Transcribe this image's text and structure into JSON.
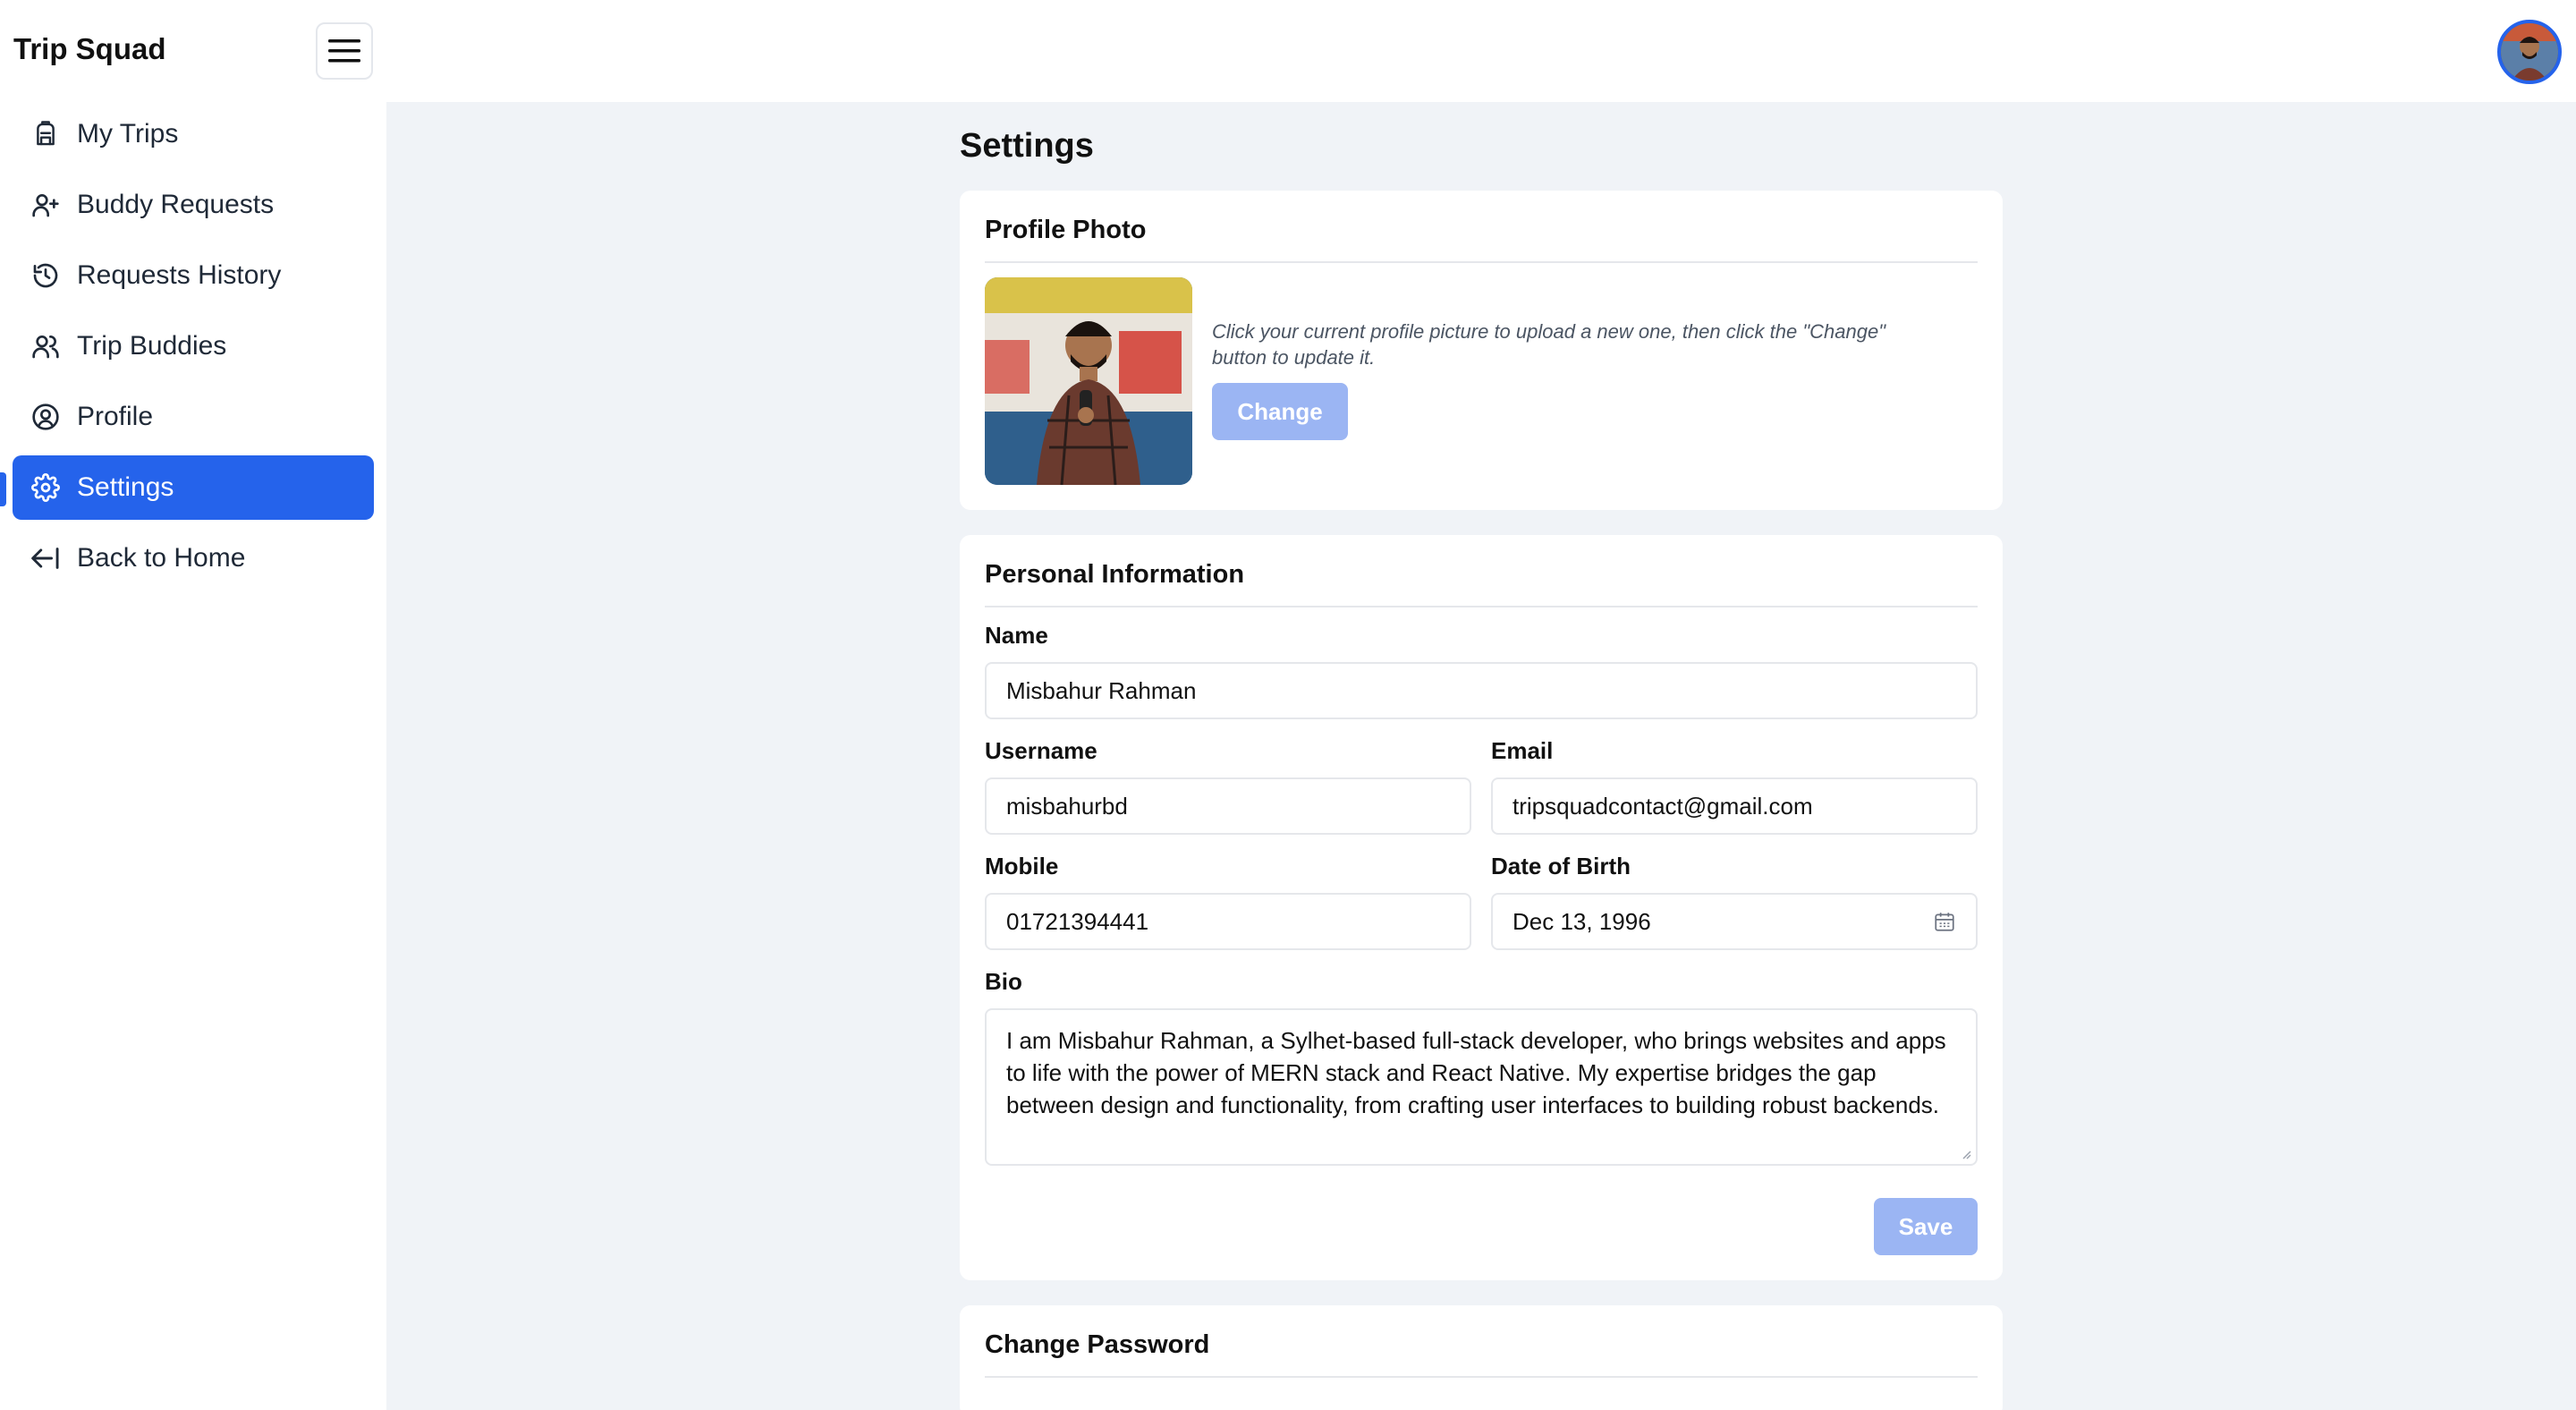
{
  "app": {
    "title": "Trip Squad"
  },
  "sidebar": {
    "items": [
      {
        "label": "My Trips",
        "icon": "backpack-icon"
      },
      {
        "label": "Buddy Requests",
        "icon": "user-plus-icon"
      },
      {
        "label": "Requests History",
        "icon": "history-icon"
      },
      {
        "label": "Trip Buddies",
        "icon": "users-icon"
      },
      {
        "label": "Profile",
        "icon": "user-circle-icon"
      },
      {
        "label": "Settings",
        "icon": "gear-icon",
        "active": true
      },
      {
        "label": "Back to Home",
        "icon": "arrow-left-bar-icon"
      }
    ]
  },
  "page": {
    "title": "Settings"
  },
  "profile_photo": {
    "title": "Profile Photo",
    "hint": "Click your current profile picture to upload a new one, then click the \"Change\" button to update it.",
    "change_label": "Change"
  },
  "personal_info": {
    "title": "Personal Information",
    "name": {
      "label": "Name",
      "value": "Misbahur Rahman"
    },
    "username": {
      "label": "Username",
      "value": "misbahurbd"
    },
    "email": {
      "label": "Email",
      "value": "tripsquadcontact@gmail.com"
    },
    "mobile": {
      "label": "Mobile",
      "value": "01721394441"
    },
    "dob": {
      "label": "Date of Birth",
      "value": "Dec 13, 1996"
    },
    "bio": {
      "label": "Bio",
      "value": "I am Misbahur Rahman, a Sylhet-based full-stack developer, who brings websites and apps to life with the power of MERN stack and React Native. My expertise bridges the gap between design and functionality, from crafting user interfaces to building robust backends."
    },
    "save_label": "Save"
  },
  "change_password": {
    "title": "Change Password"
  },
  "colors": {
    "accent": "#2563eb",
    "button_disabled": "#9bb5f3",
    "background": "#f0f3f7"
  }
}
